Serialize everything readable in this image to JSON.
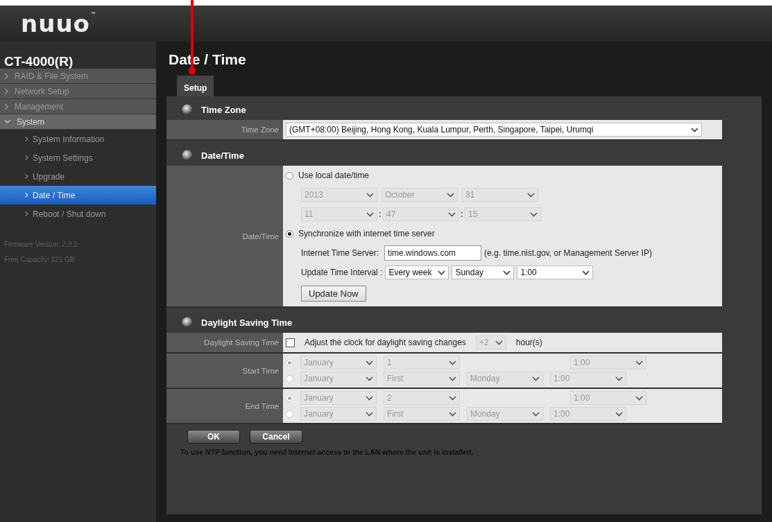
{
  "logo": {
    "text": "nuuo",
    "mark": "™"
  },
  "sidebar": {
    "device": "CT-4000(R)",
    "items": [
      {
        "label": "RAID & File System",
        "expanded": false
      },
      {
        "label": "Network Setup",
        "expanded": false
      },
      {
        "label": "Management",
        "expanded": false
      },
      {
        "label": "System",
        "expanded": true,
        "children": [
          {
            "label": "System Information",
            "selected": false
          },
          {
            "label": "System Settings",
            "selected": false
          },
          {
            "label": "Upgrade",
            "selected": false
          },
          {
            "label": "Date / Time",
            "selected": true
          },
          {
            "label": "Reboot / Shut down",
            "selected": false
          }
        ]
      }
    ],
    "info": [
      "Firmware Version: 2.0.3",
      "Free Capacity: 121 GB"
    ]
  },
  "page_title": "Date / Time",
  "tabs": [
    {
      "label": "Setup",
      "selected": true
    }
  ],
  "time_zone": {
    "title": "Time Zone",
    "label": "Time Zone",
    "value": "(GMT+08:00) Beijing, Hong Kong, Kuala Lumpur, Perth, Singapore, Taipei, Urumqi"
  },
  "date_time": {
    "title": "Date/Time",
    "label": "Date/Time",
    "options": [
      {
        "kind": "local",
        "label": "Use local date/time",
        "selected": false,
        "date": [
          "2013",
          "October",
          "31"
        ],
        "time": [
          "11",
          "47",
          "15"
        ],
        "separator": ":"
      },
      {
        "kind": "sync",
        "label": "Synchronize with internet time server",
        "selected": true,
        "server_label": "Internet Time Server:",
        "server_value": "time.windows.com",
        "hint": "(e.g. time.nist.gov, or Management Server IP)",
        "interval_label": "Update Time Interval :",
        "interval": [
          "Every week",
          "Sunday",
          "1:00"
        ],
        "button": "Update Now"
      }
    ]
  },
  "dst": {
    "title": "Daylight Saving Time",
    "label": "Daylight Saving Time",
    "checked": false,
    "text": "Adjust the clock for daylight saving changes",
    "offset": "+2",
    "unit": "hour(s)",
    "rows": [
      {
        "label": "Start Time",
        "modes": [
          {
            "kind": "date",
            "selected": true,
            "values": [
              "January",
              "1",
              "1:00"
            ]
          },
          {
            "kind": "weekday",
            "selected": false,
            "values": [
              "January",
              "First",
              "Monday",
              "1:00"
            ]
          }
        ]
      },
      {
        "label": "End Time",
        "modes": [
          {
            "kind": "date",
            "selected": true,
            "values": [
              "January",
              "2",
              "1:00"
            ]
          },
          {
            "kind": "weekday",
            "selected": false,
            "values": [
              "January",
              "First",
              "Monday",
              "1:00"
            ]
          }
        ]
      }
    ]
  },
  "buttons": [
    "OK",
    "Cancel"
  ],
  "note": "To use NTP function, you need Internet access to the LAN where the unit is installed."
}
